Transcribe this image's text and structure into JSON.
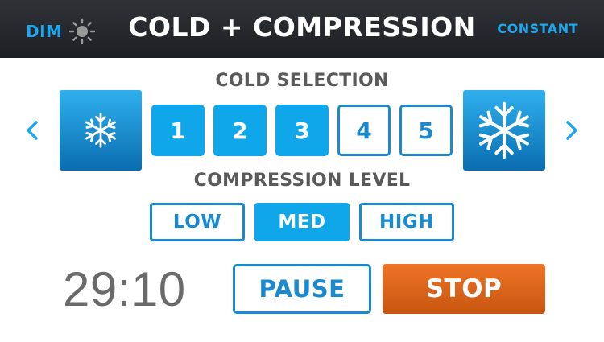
{
  "header": {
    "dim_label": "DIM",
    "dim_icon": "sun-icon",
    "title": "COLD + COMPRESSION",
    "mode_label": "CONSTANT"
  },
  "cold_selection": {
    "label": "COLD SELECTION",
    "decrease_icon": "chevron-left-icon",
    "increase_icon": "chevron-right-icon",
    "min_icon": "snowflake-icon",
    "max_icon": "snowflake-icon",
    "levels": [
      {
        "label": "1",
        "active": true
      },
      {
        "label": "2",
        "active": true
      },
      {
        "label": "3",
        "active": true
      },
      {
        "label": "4",
        "active": false
      },
      {
        "label": "5",
        "active": false
      }
    ],
    "selected_level": 3
  },
  "compression": {
    "label": "COMPRESSION LEVEL",
    "options": [
      {
        "label": "LOW",
        "active": false
      },
      {
        "label": "MED",
        "active": true
      },
      {
        "label": "HIGH",
        "active": false
      }
    ],
    "selected": "MED"
  },
  "session": {
    "timer": "29:10",
    "pause_label": "PAUSE",
    "stop_label": "STOP"
  },
  "colors": {
    "accent_blue": "#10a6ea",
    "outline_blue": "#1a8ad0",
    "stop_orange": "#e56a1c",
    "header_bg": "#26292d",
    "label_gray": "#5a5a5a"
  }
}
